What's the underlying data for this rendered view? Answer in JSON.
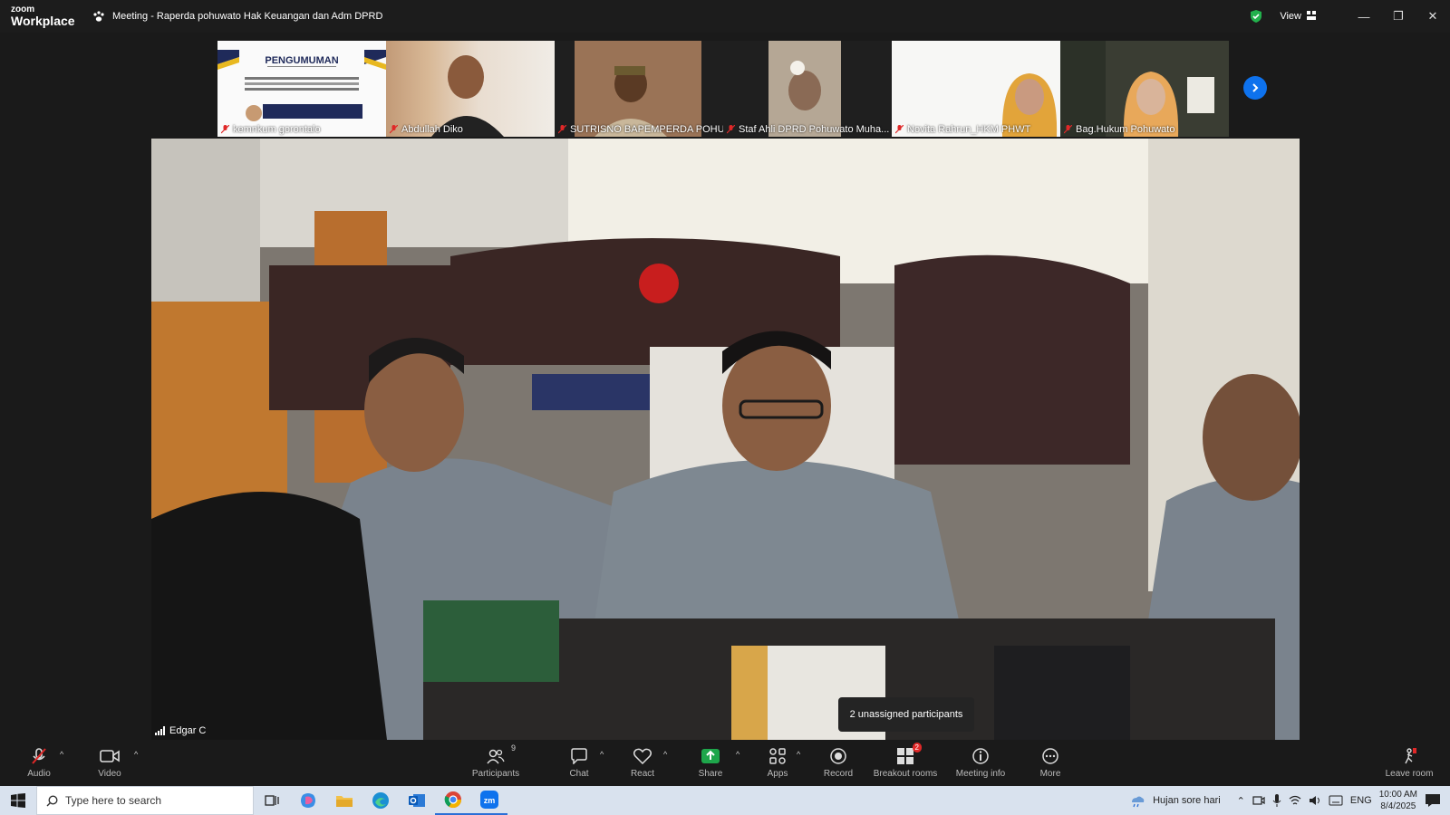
{
  "app": {
    "brand_line1": "zoom",
    "brand_line2": "Workplace"
  },
  "meeting": {
    "title": "Meeting - Raperda pohuwato Hak Keuangan dan Adm DPRD"
  },
  "titlebar": {
    "view_label": "View"
  },
  "gallery": {
    "tiles": [
      {
        "name": "kemnkum gorontalo",
        "slide_title": "PENGUMUMAN"
      },
      {
        "name": "Abdullah Diko"
      },
      {
        "name": "SUTRISNO BAPEMPERDA POHU..."
      },
      {
        "name": "Staf Ahli DPRD Pohuwato Muha..."
      },
      {
        "name": "Novita Rahrun_HKM PHWT"
      },
      {
        "name": "Bag.Hukum Pohuwato"
      }
    ]
  },
  "main_video": {
    "speaker_name": "Edgar C"
  },
  "toast": {
    "text": "2 unassigned participants"
  },
  "toolbar": {
    "audio": "Audio",
    "video": "Video",
    "participants": "Participants",
    "participants_count": "9",
    "chat": "Chat",
    "react": "React",
    "share": "Share",
    "apps": "Apps",
    "record": "Record",
    "breakout": "Breakout rooms",
    "breakout_badge": "2",
    "meeting_info": "Meeting info",
    "more": "More",
    "leave": "Leave room"
  },
  "taskbar": {
    "search_placeholder": "Type here to search",
    "weather": "Hujan sore hari",
    "lang": "ENG",
    "time": "10:00 AM",
    "date": "8/4/2025"
  },
  "colors": {
    "accent": "#0e72ed",
    "share_green": "#1ea64b",
    "alert_red": "#e02828"
  }
}
